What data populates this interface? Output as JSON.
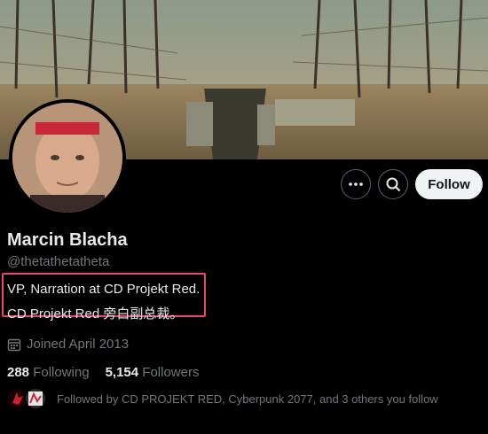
{
  "profile": {
    "display_name": "Marcin Blacha",
    "handle": "@thetathetatheta",
    "bio_line1": "VP, Narration at CD Projekt Red.",
    "bio_line2": "CD Projekt Red 旁白副总裁。",
    "joined": "Joined April 2013",
    "following_count": "288",
    "following_label": "Following",
    "followers_count": "5,154",
    "followers_label": "Followers",
    "followed_by": "Followed by CD PROJEKT RED, Cyberpunk 2077, and 3 others you follow"
  },
  "actions": {
    "follow_label": "Follow",
    "more_icon": "more-icon",
    "search_icon": "search-icon"
  },
  "colors": {
    "background": "#000000",
    "highlight_box": "#e8466a",
    "follow_button_bg": "#eff3f4",
    "muted_text": "#71767b"
  }
}
